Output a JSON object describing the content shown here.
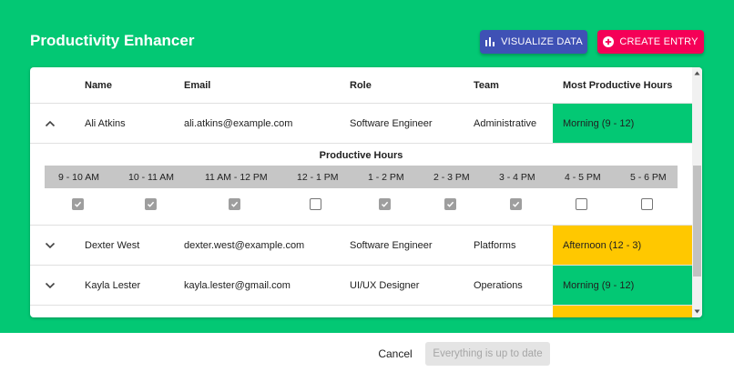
{
  "app": {
    "title": "Productivity Enhancer",
    "visualize_label": "VISUALIZE DATA",
    "create_label": "CREATE ENTRY"
  },
  "colors": {
    "header_green": "#03c874",
    "visualize_blue": "#3f51b5",
    "create_pink": "#f50057",
    "morning_green": "#03c874",
    "afternoon_yellow": "#ffc800"
  },
  "table": {
    "columns": [
      "Name",
      "Email",
      "Role",
      "Team",
      "Most Productive Hours"
    ],
    "rows": [
      {
        "name": "Ali Atkins",
        "email": "ali.atkins@example.com",
        "role": "Software Engineer",
        "team": "Administrative",
        "hours": "Morning (9 - 12)",
        "expanded": true,
        "icon": "chevron-up-icon"
      },
      {
        "name": "Dexter West",
        "email": "dexter.west@example.com",
        "role": "Software Engineer",
        "team": "Platforms",
        "hours": "Afternoon (12 - 3)",
        "expanded": false,
        "icon": "chevron-down-icon"
      },
      {
        "name": "Kayla Lester",
        "email": "kayla.lester@gmail.com",
        "role": "UI/UX Designer",
        "team": "Operations",
        "hours": "Morning (9 - 12)",
        "expanded": false,
        "icon": "chevron-down-icon"
      }
    ]
  },
  "detail": {
    "title": "Productive Hours",
    "slots": [
      "9 - 10 AM",
      "10 - 11 AM",
      "11 AM - 12 PM",
      "12 - 1 PM",
      "1 - 2 PM",
      "2 - 3 PM",
      "3 - 4 PM",
      "4 - 5 PM",
      "5 - 6 PM"
    ],
    "checked": [
      true,
      true,
      true,
      false,
      true,
      true,
      true,
      false,
      false
    ]
  },
  "footer": {
    "cancel_label": "Cancel",
    "status_label": "Everything is up to date"
  }
}
